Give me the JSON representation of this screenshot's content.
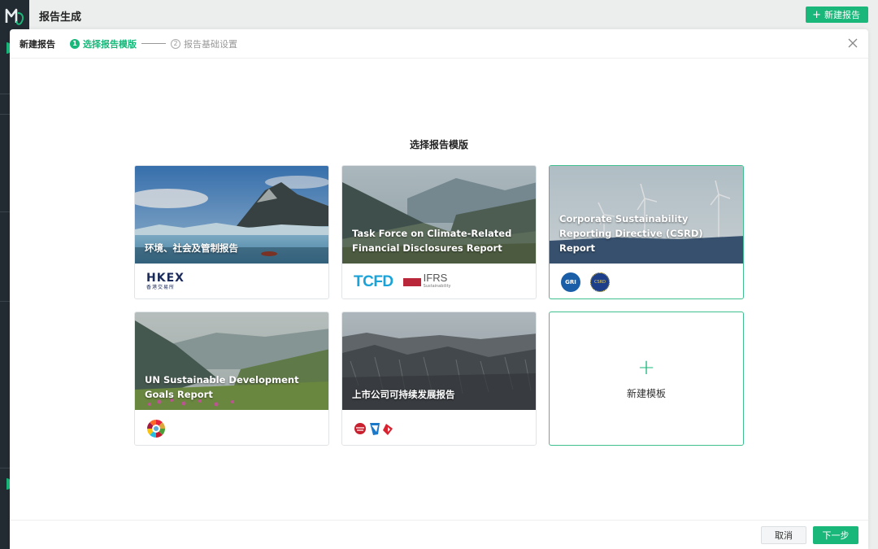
{
  "app": {
    "title": "报告生成",
    "new_report_button": "新建报告"
  },
  "modal": {
    "title": "新建报告",
    "steps": [
      {
        "num": "1",
        "label": "选择报告模版",
        "state": "active"
      },
      {
        "num": "2",
        "label": "报告基础设置",
        "state": "inactive"
      }
    ],
    "section_title": "选择报告模版",
    "templates": [
      {
        "label": "环境、社会及管制报告",
        "logos": [
          "hkex-logo"
        ],
        "hkex_text": "HKEX",
        "hkex_sub": "香港交易所"
      },
      {
        "label": "Task Force on Climate-Related Financial Disclosures Report",
        "logos": [
          "tcfd-logo",
          "ifrs-logo"
        ],
        "tcfd_text": "TCFD",
        "ifrs_text": "IFRS",
        "ifrs_sub": "Sustainability"
      },
      {
        "label": "Corporate Sustainability Reporting Directive (CSRD) Report",
        "logos": [
          "gri-logo",
          "csrd-logo"
        ],
        "gri_text": "GRI",
        "csrd_text": "CSRD",
        "selected": true
      },
      {
        "label": "UN Sustainable Development Goals Report",
        "logos": [
          "sdg-wheel-logo"
        ]
      },
      {
        "label": "上市公司可持续发展报告",
        "logos": [
          "exchange-logos"
        ]
      }
    ],
    "new_template_label": "新建模板",
    "footer": {
      "cancel": "取消",
      "next": "下一步"
    }
  },
  "colors": {
    "accent": "#19b77a",
    "rail": "#232b32"
  }
}
